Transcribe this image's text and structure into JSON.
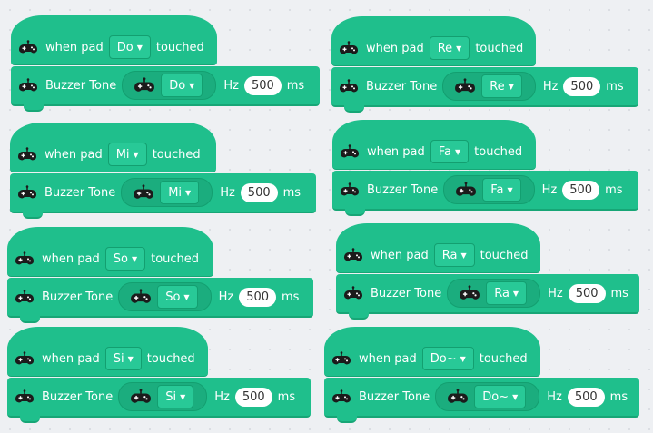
{
  "labels": {
    "when_pad": "when pad",
    "touched": "touched",
    "buzzer_tone": "Buzzer Tone",
    "hz": "Hz",
    "ms": "ms"
  },
  "icons": {
    "block_icon": "gamepad-icon",
    "dropdown_arrow": "caret-down-icon"
  },
  "colors": {
    "block": "#1fbf8c",
    "dropdown": "#28c997",
    "background": "#eef0f3"
  },
  "blocks": [
    {
      "pad": "Do",
      "tone": "Do",
      "hz": "500"
    },
    {
      "pad": "Re",
      "tone": "Re",
      "hz": "500"
    },
    {
      "pad": "Mi",
      "tone": "Mi",
      "hz": "500"
    },
    {
      "pad": "Fa",
      "tone": "Fa",
      "hz": "500"
    },
    {
      "pad": "So",
      "tone": "So",
      "hz": "500"
    },
    {
      "pad": "Ra",
      "tone": "Ra",
      "hz": "500"
    },
    {
      "pad": "Si",
      "tone": "Si",
      "hz": "500"
    },
    {
      "pad": "Do~",
      "tone": "Do~",
      "hz": "500"
    }
  ]
}
